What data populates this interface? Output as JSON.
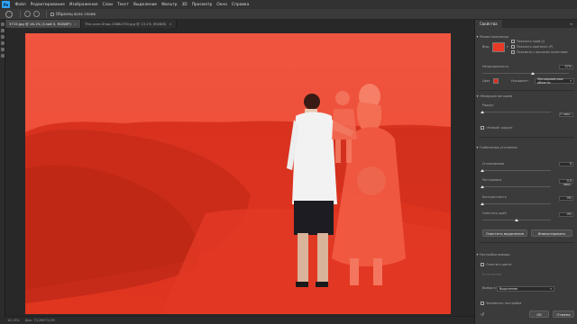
{
  "menu": {
    "logo": "Ps",
    "items": [
      "Файл",
      "Редактирование",
      "Изображение",
      "Слои",
      "Текст",
      "Выделение",
      "Фильтр",
      "3D",
      "Просмотр",
      "Окно",
      "Справка"
    ]
  },
  "options_bar": {
    "sample_all_layers": "Образец всех слоев"
  },
  "tabs": [
    {
      "label": "3715.jpg @ 16,1% (Слой 0, RGB/8*)",
      "active": true
    },
    {
      "label": "The-Love-Shop-1988x700.jpg @ 13,1% (RGB/8)",
      "active": false
    }
  ],
  "status": {
    "zoom": "16,13%",
    "doc": "Док: 73,2M/73,2M"
  },
  "panel": {
    "title": "Свойства",
    "view_mode_title": "Режим просмотра",
    "view_label": "Вид:",
    "show_edge": "Показать край (J)",
    "show_original": "Показать оригинал (P)",
    "realtime_refine": "Просмотр с высоким качеством",
    "opacity_label": "Непрозрачность",
    "opacity_value": "57%",
    "color_label": "Цвет",
    "indicates_label": "Указывает:",
    "indicates_value": "Маскированные области",
    "edge_detection": "Обнаружение краев",
    "radius_label": "Радиус",
    "radius_value": "0 пикс.",
    "smart_radius": "«Умный» радиус",
    "global_refine": "Глобальные уточнения",
    "smooth_label": "Сглаживание",
    "smooth_value": "0",
    "feather_label": "Растушевка",
    "feather_value": "0,0 пикс.",
    "contrast_label": "Контрастность",
    "contrast_value": "0%",
    "shift_edge_label": "Сместить край",
    "shift_edge_value": "0%",
    "clear_selection": "Очистить выделение",
    "invert": "Инвертировать",
    "output_settings": "Настройки вывода",
    "decontaminate": "Очистить цвета",
    "amount_label": "Количество",
    "output_to_label": "Вывод в:",
    "output_to_value": "Выделение",
    "remember": "Запомнить настройки",
    "ok": "OK",
    "cancel": "Отмена"
  }
}
